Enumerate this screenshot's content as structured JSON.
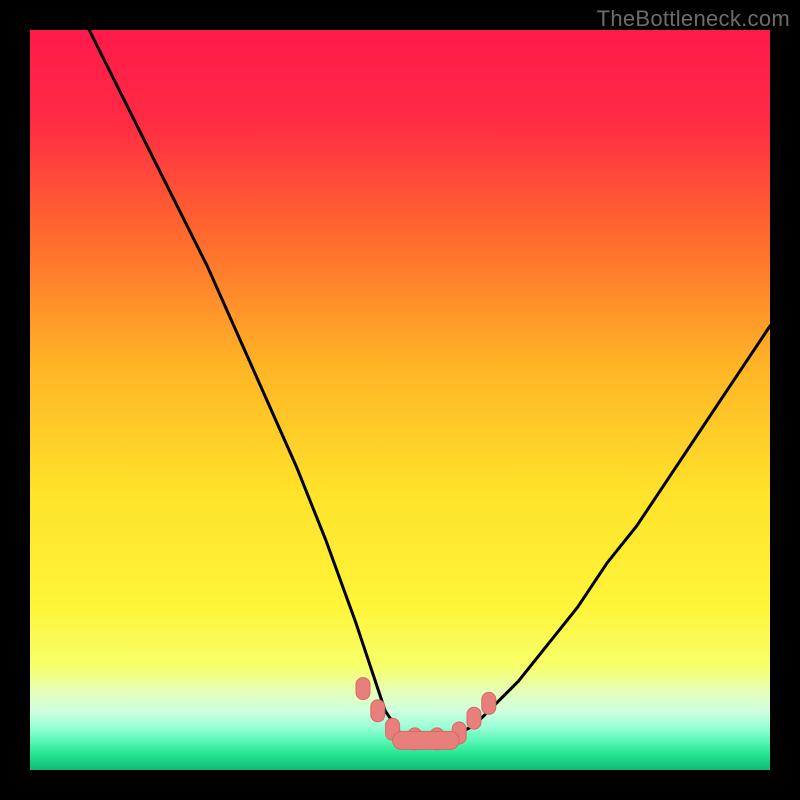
{
  "watermark": "TheBottleneck.com",
  "colors": {
    "frame": "#000000",
    "gradient_stops": [
      {
        "offset": 0.0,
        "color": "#ff1a4b"
      },
      {
        "offset": 0.12,
        "color": "#ff2a44"
      },
      {
        "offset": 0.28,
        "color": "#ff6a2e"
      },
      {
        "offset": 0.45,
        "color": "#ffb326"
      },
      {
        "offset": 0.62,
        "color": "#ffe12a"
      },
      {
        "offset": 0.78,
        "color": "#fff53a"
      },
      {
        "offset": 0.86,
        "color": "#f7ff6a"
      },
      {
        "offset": 0.89,
        "color": "#e8ffb0"
      },
      {
        "offset": 0.92,
        "color": "#cfffe0"
      },
      {
        "offset": 0.94,
        "color": "#a0ffd8"
      },
      {
        "offset": 0.96,
        "color": "#5cf7b6"
      },
      {
        "offset": 0.98,
        "color": "#22e38f"
      },
      {
        "offset": 1.0,
        "color": "#0fb977"
      }
    ],
    "curve_stroke": "#000000",
    "marker_fill": "#e97f7a",
    "marker_stroke": "#d46a65"
  },
  "chart_data": {
    "type": "line",
    "title": "",
    "xlabel": "",
    "ylabel": "",
    "xlim": [
      0,
      100
    ],
    "ylim": [
      0,
      100
    ],
    "note": "Axes are normalized 0–100 (no tick labels shown in image). Curve is a V-shaped bottleneck curve; y≈100 is top (red), y≈0 is bottom (green). Minimum plateau around x≈48–60 at y≈4.",
    "series": [
      {
        "name": "bottleneck-curve",
        "x": [
          8,
          12,
          16,
          20,
          24,
          28,
          32,
          36,
          40,
          44,
          46,
          48,
          50,
          52,
          54,
          56,
          58,
          60,
          62,
          66,
          70,
          74,
          78,
          82,
          86,
          90,
          94,
          98,
          100
        ],
        "y": [
          100,
          92,
          84,
          76,
          68,
          59,
          50,
          41,
          31,
          20,
          14,
          8,
          5,
          4,
          4,
          4,
          5,
          6,
          8,
          12,
          17,
          22,
          28,
          33,
          39,
          45,
          51,
          57,
          60
        ]
      }
    ],
    "markers": {
      "name": "plateau-markers",
      "shape": "rounded-pill",
      "points_x": [
        45,
        47,
        49,
        52,
        55,
        58,
        60,
        62
      ],
      "points_y": [
        11,
        8,
        5.5,
        4.2,
        4.2,
        5,
        7,
        9
      ]
    }
  }
}
